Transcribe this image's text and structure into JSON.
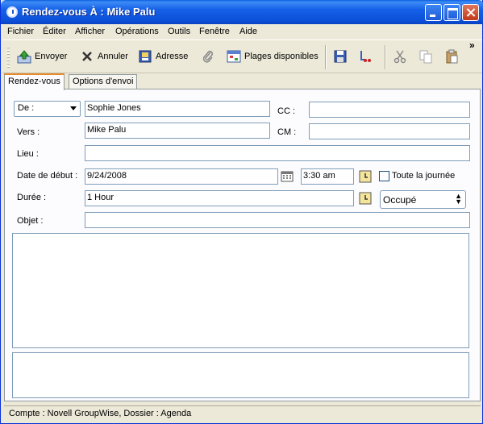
{
  "window": {
    "title": "Rendez-vous À : Mike Palu"
  },
  "menu": [
    "Fichier",
    "Éditer",
    "Afficher",
    "Opérations",
    "Outils",
    "Fenêtre",
    "Aide"
  ],
  "toolbar": {
    "send": "Envoyer",
    "cancel": "Annuler",
    "address": "Adresse",
    "busy_search": "Plages disponibles",
    "overflow": "»"
  },
  "tabs": [
    "Rendez-vous",
    "Options d'envoi"
  ],
  "form": {
    "from_label": "De :",
    "from_value": "Sophie Jones",
    "to_label": "Vers :",
    "to_value": "Mike Palu",
    "cc_label": "CC :",
    "cc_value": "",
    "bc_label": "CM :",
    "bc_value": "",
    "place_label": "Lieu :",
    "place_value": "",
    "start_label": "Date de début :",
    "start_date": "9/24/2008",
    "start_time": "3:30 am",
    "allday_label": "Toute la journée",
    "duration_label": "Durée :",
    "duration_value": "1 Hour",
    "show_as": "Occupé",
    "subject_label": "Objet :",
    "subject_value": ""
  },
  "status": "Compte : Novell GroupWise,  Dossier : Agenda"
}
